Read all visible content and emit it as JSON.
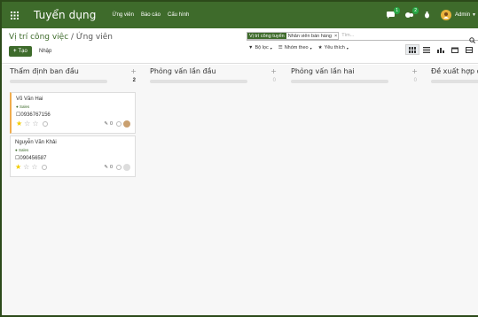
{
  "navbar": {
    "brand": "Tuyển dụng",
    "menus": [
      "Ứng viên",
      "Báo cáo",
      "Cấu hình"
    ],
    "user": "Admin",
    "chat_badge": "1",
    "activity_badge": "2"
  },
  "control": {
    "breadcrumb_parent": "Vị trí công việc",
    "breadcrumb_sep": " / ",
    "breadcrumb_current": "Ứng viên",
    "new_label": "Tạo",
    "import_label": "Nhập",
    "facet_label": "Vị trí công tuyển",
    "facet_value": "Nhân viên bán hàng",
    "facet_remove": "×",
    "search_placeholder": "Tìm...",
    "filter_label": "Bộ lọc",
    "groupby_label": "Nhóm theo",
    "favorite_label": "Yêu thích"
  },
  "columns": [
    {
      "title": "Thẩm định ban đầu",
      "count": "2",
      "progress": 1.0
    },
    {
      "title": "Phỏng vấn lần đầu",
      "count": "0",
      "progress": 0.0
    },
    {
      "title": "Phỏng vấn lần hai",
      "count": "0",
      "progress": 0.0
    },
    {
      "title": "Đề xuất hợp đồng",
      "count": "",
      "progress": 0.0
    }
  ],
  "cards": [
    {
      "name": "Võ Văn Hai",
      "tag": "Sales",
      "phone": "0936767156",
      "attachments": "0",
      "stars": 1
    },
    {
      "name": "Nguyễn Văn Khải",
      "tag": "Sales",
      "phone": "090456587",
      "attachments": "0",
      "stars": 1
    }
  ],
  "colors": {
    "brand": "#3e6b2b",
    "star": "#f3cc00",
    "highlight": "#f0ad4e"
  }
}
